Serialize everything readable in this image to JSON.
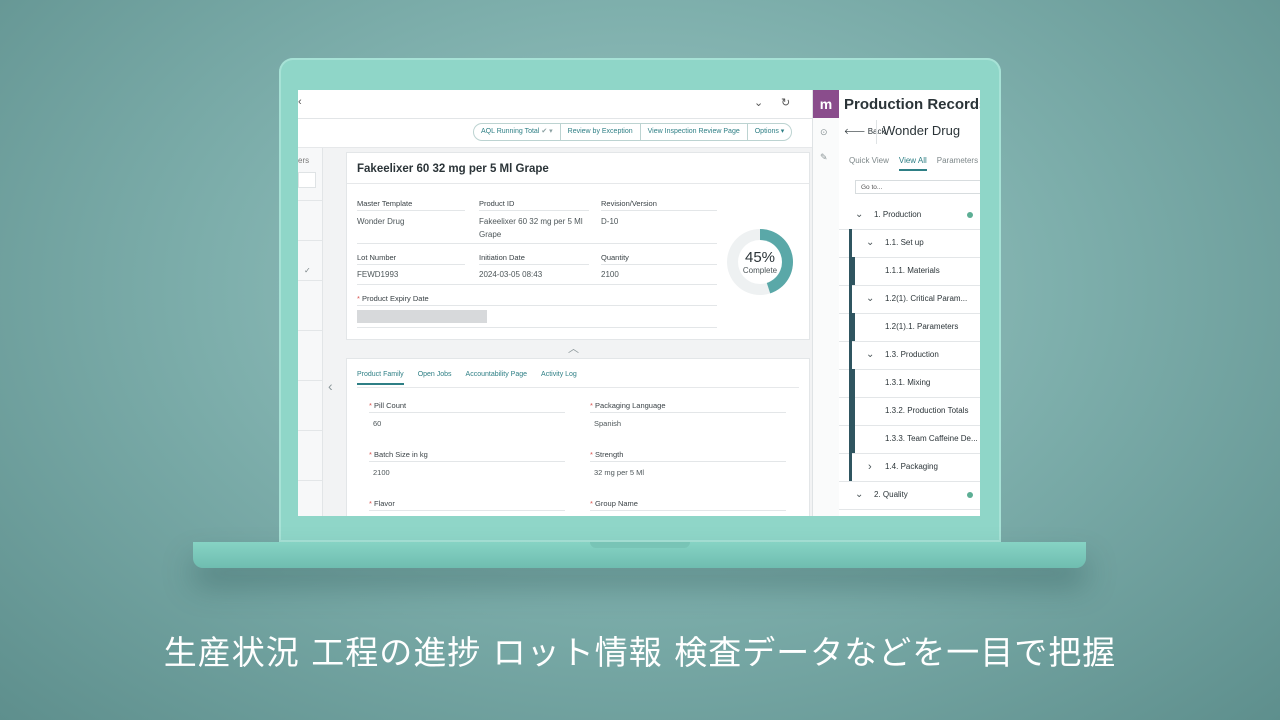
{
  "app": {
    "topbar": {
      "chevron_icon": "chevron-down-icon",
      "refresh_icon": "refresh-icon"
    },
    "actions": {
      "aql": "AQL Running Total",
      "review": "Review by Exception",
      "inspection": "View Inspection Review Page",
      "options": "Options"
    },
    "left_panel": {
      "partial_label": "ers"
    },
    "record": {
      "title": "Fakeelixer 60 32 mg per 5 Ml Grape",
      "fields": {
        "master_template_label": "Master Template",
        "master_template_value": "Wonder Drug",
        "product_id_label": "Product ID",
        "product_id_value": "Fakeelixer 60 32 mg per 5 Ml Grape",
        "revision_label": "Revision/Version",
        "revision_value": "D-10",
        "lot_label": "Lot Number",
        "lot_value": "FEWD1993",
        "initiation_label": "Initiation Date",
        "initiation_value": "2024-03-05 08:43",
        "quantity_label": "Quantity",
        "quantity_value": "2100",
        "expiry_label": "Product Expiry Date"
      },
      "progress": {
        "percent_text": "45%",
        "label": "Complete",
        "fraction": 0.45,
        "color": "#5aa8a8"
      }
    },
    "detail_tabs": [
      "Product Family",
      "Open Jobs",
      "Accountability Page",
      "Activity Log"
    ],
    "product_fields": {
      "pill_count_label": "Pill Count",
      "pill_count_value": "60",
      "packaging_label": "Packaging Language",
      "packaging_value": "Spanish",
      "batch_label": "Batch Size in kg",
      "batch_value": "2100",
      "strength_label": "Strength",
      "strength_value": "32 mg per 5 Ml",
      "flavor_label": "Flavor",
      "group_label": "Group Name"
    },
    "production_records": {
      "logo": "m",
      "title": "Production Records",
      "back": "Back",
      "drug": "Wonder Drug",
      "tabs": [
        "Quick View",
        "View All",
        "Parameters"
      ],
      "goto_placeholder": "Go to...",
      "tree": [
        {
          "label": "1.  Production"
        },
        {
          "label": "1.1.  Set up"
        },
        {
          "label": "1.1.1.  Materials"
        },
        {
          "label": "1.2(1).  Critical Param..."
        },
        {
          "label": "1.2(1).1.  Parameters"
        },
        {
          "label": "1.3.  Production"
        },
        {
          "label": "1.3.1.  Mixing"
        },
        {
          "label": "1.3.2.  Production Totals"
        },
        {
          "label": "1.3.3.  Team Caffeine De..."
        },
        {
          "label": "1.4.  Packaging"
        },
        {
          "label": "2.  Quality"
        }
      ]
    }
  },
  "caption": "生産状況 工程の進捗 ロット情報 検査データなどを一目で把握",
  "colors": {
    "accent": "#2e7f85",
    "brand": "#8a4d8c",
    "status_dot": "#5cae94"
  }
}
